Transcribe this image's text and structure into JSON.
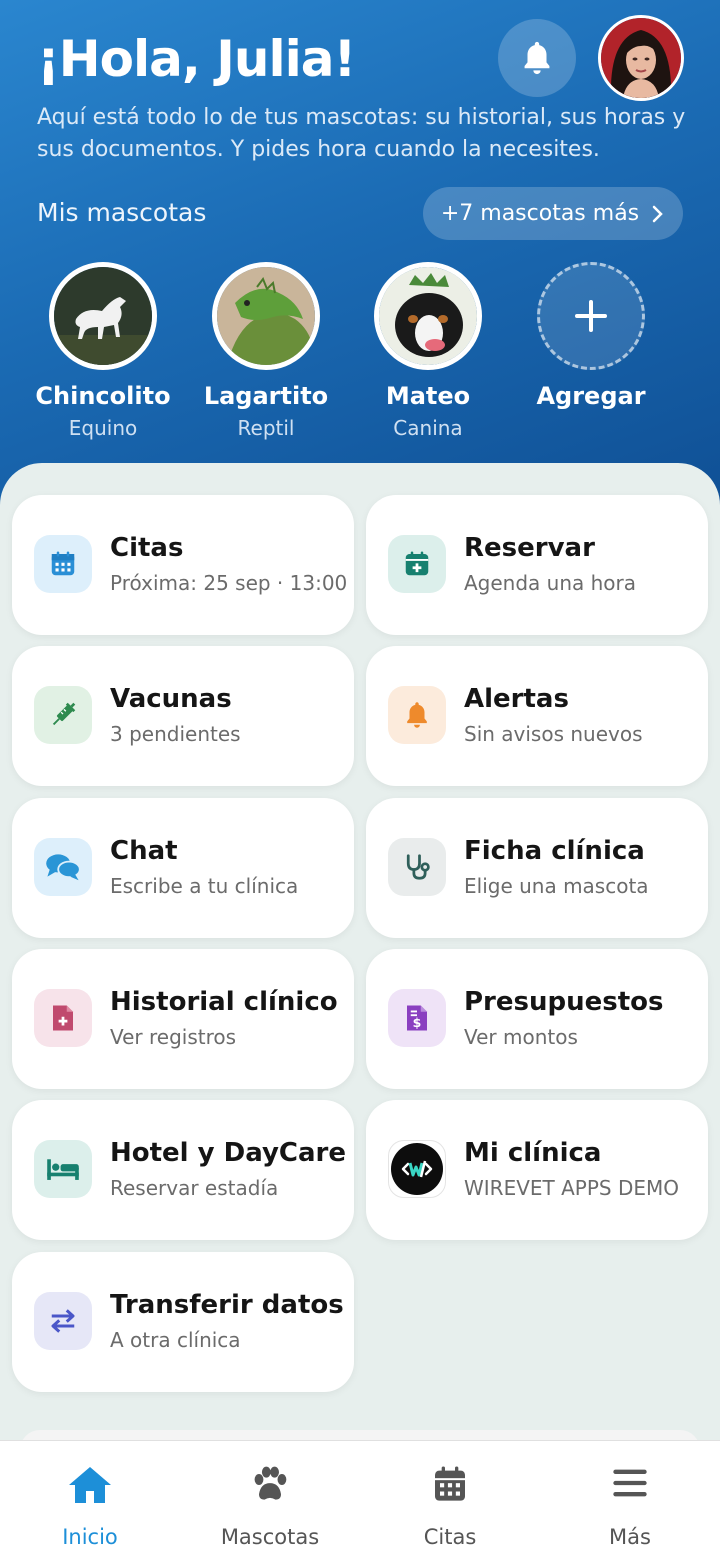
{
  "header": {
    "greeting": "¡Hola, Julia!",
    "subtitle": "Aquí está todo lo de tus mascotas: su historial, sus horas y sus documentos. Y pides hora cuando la necesites.",
    "bell_icon": "bell-icon",
    "avatar": "user-avatar"
  },
  "pets": {
    "label": "Mis mascotas",
    "more_label": "+7 mascotas más",
    "items": [
      {
        "name": "Chincolito",
        "species": "Equino"
      },
      {
        "name": "Lagartito",
        "species": "Reptil"
      },
      {
        "name": "Mateo",
        "species": "Canina"
      },
      {
        "name": "Agregar",
        "species": ""
      }
    ]
  },
  "cards": [
    {
      "title": "Citas",
      "sub": "Próxima: 25 sep · 13:00",
      "icon": "calendar-icon",
      "color": "#2a8fd6",
      "bg": "#ddeffb"
    },
    {
      "title": "Reservar",
      "sub": "Agenda una hora",
      "icon": "calendar-plus-icon",
      "color": "#17806f",
      "bg": "#dcefeb"
    },
    {
      "title": "Vacunas",
      "sub": "3 pendientes",
      "icon": "syringe-icon",
      "color": "#2e8b4f",
      "bg": "#e1f1e4"
    },
    {
      "title": "Alertas",
      "sub": "Sin avisos nuevos",
      "icon": "bell-icon",
      "color": "#ee8a2c",
      "bg": "#fcebdc"
    },
    {
      "title": "Chat",
      "sub": "Escribe a tu clínica",
      "icon": "chat-icon",
      "color": "#2a95d6",
      "bg": "#ddeffb"
    },
    {
      "title": "Ficha clínica",
      "sub": "Elige una mascota",
      "icon": "stethoscope-icon",
      "color": "#2f5f5a",
      "bg": "#e9ecec"
    },
    {
      "title": "Historial clínico",
      "sub": "Ver registros",
      "icon": "medical-file-icon",
      "color": "#c04a6e",
      "bg": "#f7e3ea"
    },
    {
      "title": "Presupuestos",
      "sub": "Ver montos",
      "icon": "invoice-icon",
      "color": "#8a3fc0",
      "bg": "#efe3f7"
    },
    {
      "title": "Hotel y DayCare",
      "sub": "Reservar estadía",
      "icon": "bed-icon",
      "color": "#17806f",
      "bg": "#dcefeb"
    },
    {
      "title": "Mi clínica",
      "sub": "WIREVET APPS DEMO",
      "icon": "clinic-logo-icon",
      "color": "#111111",
      "bg": "#ffffff"
    },
    {
      "title": "Transferir datos",
      "sub": "A otra clínica",
      "icon": "transfer-icon",
      "color": "#4a56c8",
      "bg": "#e6e7f7"
    }
  ],
  "nav": [
    {
      "label": "Inicio",
      "icon": "home-icon",
      "active": true
    },
    {
      "label": "Mascotas",
      "icon": "paw-icon",
      "active": false
    },
    {
      "label": "Citas",
      "icon": "calendar-icon",
      "active": false
    },
    {
      "label": "Más",
      "icon": "menu-icon",
      "active": false
    }
  ],
  "colors": {
    "accent": "#1d8fd8",
    "header_start": "#2a86cf",
    "header_end": "#0f4f94"
  }
}
